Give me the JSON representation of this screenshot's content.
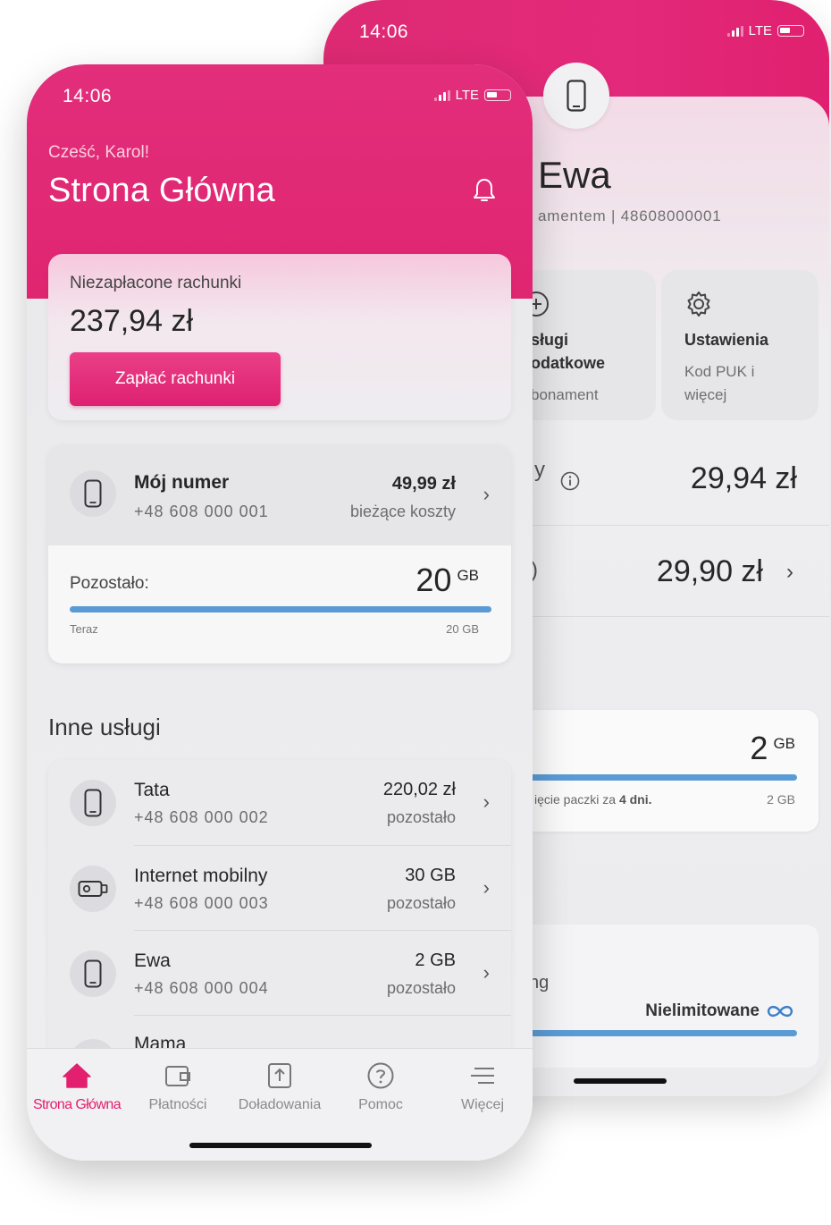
{
  "back_phone": {
    "status": {
      "time": "14:06",
      "network": "LTE"
    },
    "profile": {
      "name": "Ewa",
      "subtitle": "amentem | 48608000001"
    },
    "tiles": [
      {
        "title_line1": "sługi",
        "title_line2": "odatkowe",
        "subtitle": "bonament",
        "icon": "plus-circle-icon"
      },
      {
        "title_line1": "Ustawienia",
        "title_line2": "",
        "subtitle_line1": "Kod PUK i",
        "subtitle_line2": "więcej",
        "icon": "gear-icon"
      }
    ],
    "rows": [
      {
        "label_fragment": "y",
        "amount": "29,94 zł"
      },
      {
        "label_fragment": ")",
        "amount": "29,90 zł"
      }
    ],
    "data_card": {
      "amount": "2",
      "unit": "GB",
      "note_prefix": "ięcie paczki za ",
      "note_bold": "4 dni.",
      "max_label": "2 GB",
      "fill": 1.0
    },
    "unlimited_card": {
      "label_fragment": "ng",
      "value": "Nielimitowane",
      "fill": 1.0
    }
  },
  "front_phone": {
    "status": {
      "time": "14:06",
      "network": "LTE"
    },
    "header": {
      "greeting": "Cześć, Karol!",
      "title": "Strona Główna"
    },
    "bill": {
      "label": "Niezapłacone rachunki",
      "amount": "237,94 zł",
      "button": "Zapłać rachunki"
    },
    "my_number": {
      "title": "Mój numer",
      "number": "+48 608 000 001",
      "value": "49,99 zł",
      "caption": "bieżące koszty",
      "remaining_label": "Pozostało:",
      "remaining_value": "20",
      "remaining_unit": "GB",
      "range_start": "Teraz",
      "range_end": "20 GB",
      "fill": 1.0
    },
    "other_services_title": "Inne usługi",
    "services": [
      {
        "name": "Tata",
        "number": "+48 608 000 002",
        "value": "220,02 zł",
        "caption": "pozostało",
        "icon": "phone-icon"
      },
      {
        "name": "Internet mobilny",
        "number": "+48 608 000 003",
        "value": "30 GB",
        "caption": "pozostało",
        "icon": "modem-icon"
      },
      {
        "name": "Ewa",
        "number": "+48 608 000 004",
        "value": "2 GB",
        "caption": "pozostało",
        "icon": "phone-icon"
      },
      {
        "name": "Mama",
        "number": "",
        "value": "",
        "caption": "",
        "icon": "phone-icon"
      }
    ],
    "tabs": [
      {
        "label": "Strona Główna",
        "icon": "home-icon",
        "active": true
      },
      {
        "label": "Płatności",
        "icon": "wallet-icon",
        "active": false
      },
      {
        "label": "Doładowania",
        "icon": "topup-icon",
        "active": false
      },
      {
        "label": "Pomoc",
        "icon": "help-icon",
        "active": false
      },
      {
        "label": "Więcej",
        "icon": "menu-icon",
        "active": false
      }
    ]
  },
  "colors": {
    "brand": "#e20074",
    "progress": "#5b9bd5"
  }
}
